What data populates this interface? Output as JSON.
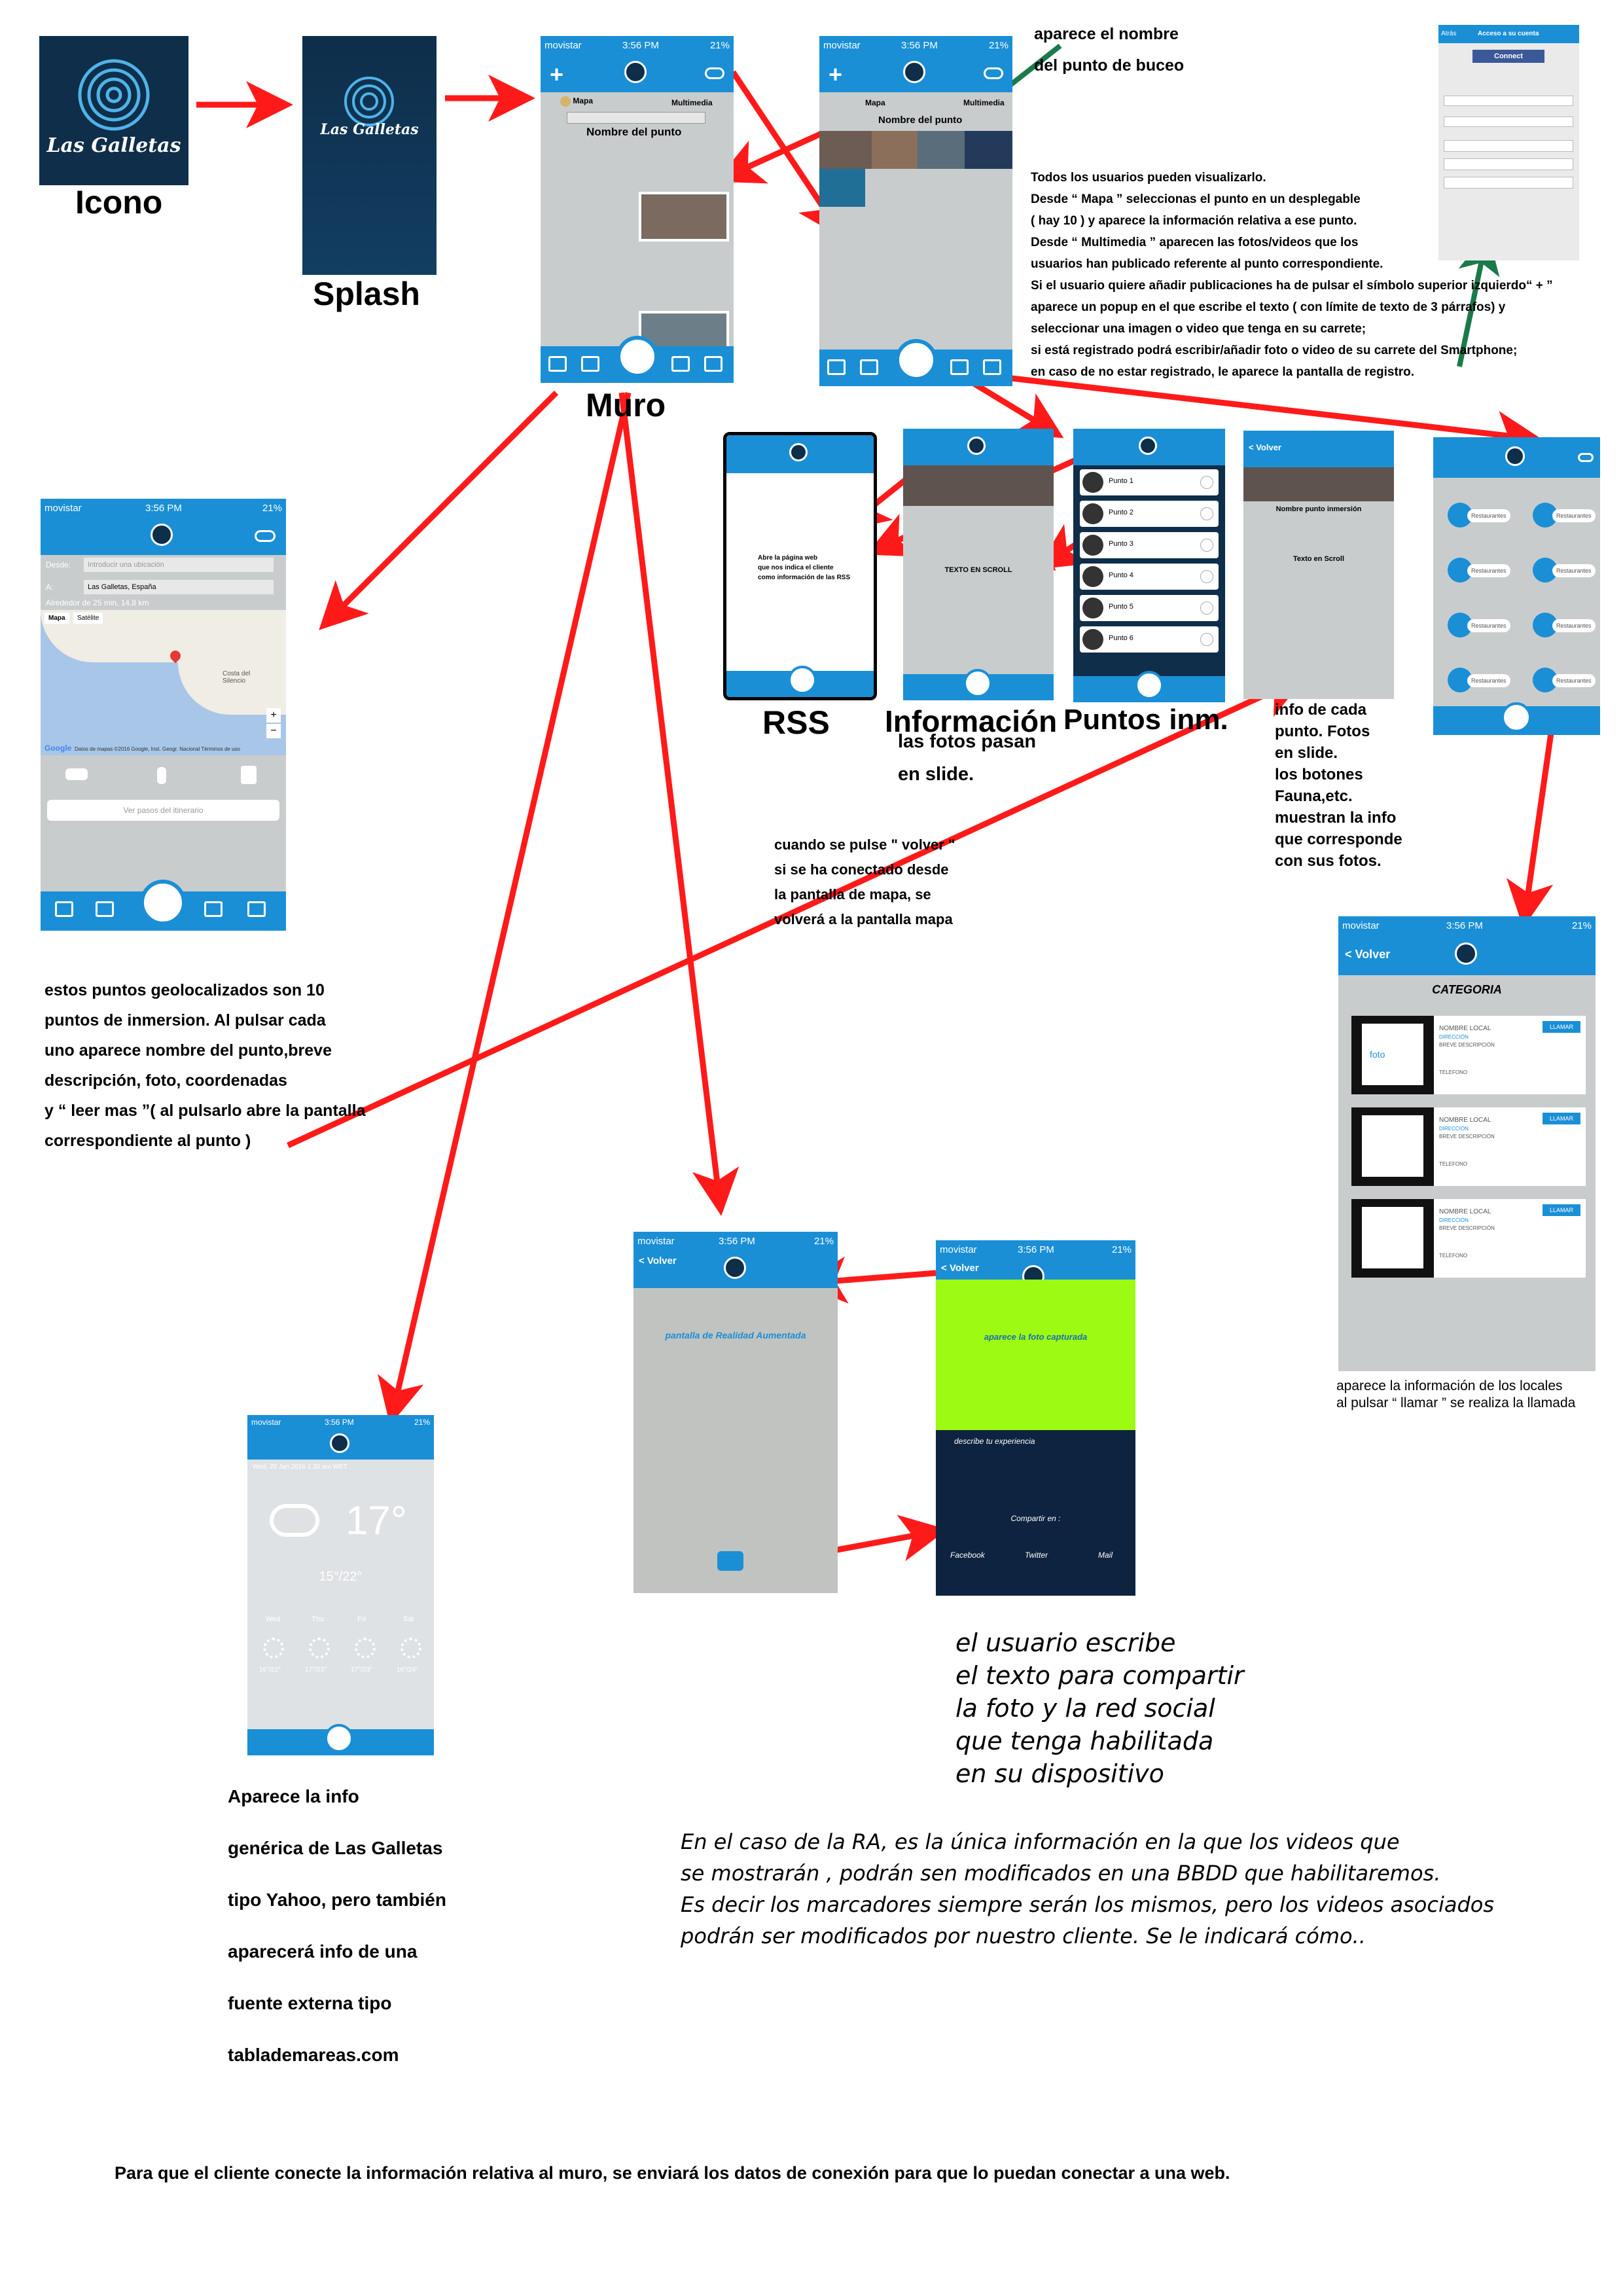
{
  "status": {
    "carrier": "movistar",
    "time": "3:56 PM",
    "battery": "21%"
  },
  "labels": {
    "icono": "Icono",
    "splash": "Splash",
    "muro": "Muro",
    "rss": "RSS",
    "informacion": "Información",
    "puntos": "Puntos inm."
  },
  "brand": {
    "logo_text": "Las Galletas",
    "primary_color": "#1a8fd6",
    "dark_color": "#0e2e4a"
  },
  "notes": {
    "buceo": [
      "aparece el nombre",
      "del punto de buceo"
    ],
    "todos": [
      "Todos los usuarios pueden visualizarlo.",
      "Desde “ Mapa ” seleccionas el punto en un desplegable",
      "( hay 10 ) y aparece la información relativa a ese punto.",
      "Desde “ Multimedia ” aparecen las fotos/videos que los",
      "usuarios han publicado referente al punto correspondiente.",
      "Si el usuario quiere añadir publicaciones ha de pulsar el símbolo superior izquierdo“ + ”",
      "aparece un popup en el que escribe el texto ( con límite de texto de 3 párrafos) y",
      "seleccionar una imagen o video que tenga en su carrete;",
      "si está registrado podrá escribir/añadir foto o video de su carrete del Smartphone;",
      "en caso de no estar registrado, le aparece la pantalla de registro."
    ],
    "fotos_slide": [
      "las fotos pasan",
      "en slide."
    ],
    "info_punto": [
      "info de cada",
      "punto. Fotos",
      "en slide.",
      "los botones",
      "Fauna,etc.",
      "muestran la info",
      "que corresponde",
      "con sus fotos."
    ],
    "volver": [
      "cuando se pulse \" volver \"",
      "si se ha conectado desde",
      "la pantalla de mapa, se",
      "volverá a la pantalla mapa"
    ],
    "geoloc": [
      "estos puntos geolocalizados son 10",
      "puntos de inmersion. Al pulsar cada",
      "uno aparece nombre del punto,breve",
      "descripción, foto, coordenadas",
      "y “ leer mas ”( al pulsarlo abre la pantalla",
      "correspondiente al punto )"
    ],
    "locales": [
      "aparece la información de los locales",
      "al pulsar “ llamar ” se realiza la llamada"
    ],
    "usuario": [
      "el usuario escribe",
      "el texto para compartir",
      "la foto y la red social",
      "que tenga habilitada",
      "en su dispositivo"
    ],
    "yahoo": [
      "Aparece la info",
      "genérica de Las Galletas",
      "tipo Yahoo, pero también",
      "aparecerá info de una",
      "fuente externa tipo",
      "tablademareas.com"
    ],
    "ra": [
      "En el caso de la RA, es la única información en la que los videos que",
      "se mostrarán , podrán sen modificados en una BBDD que habilitaremos.",
      "Es decir los marcadores siempre serán los mismos, pero los videos asociados",
      "podrán ser modificados por nuestro cliente. Se le indicará cómo.."
    ],
    "footer": "Para que el cliente conecte la información relativa al muro, se enviará los datos de conexión para que lo puedan conectar a una web."
  },
  "screens": {
    "muro": {
      "tab_map": "Mapa",
      "tab_multi": "Multimedia",
      "title": "Nombre del punto"
    },
    "multimedia": {
      "tab_map": "Mapa",
      "tab_multi": "Multimedia",
      "title": "Nombre del punto"
    },
    "login": {
      "title": "Acceso a su cuenta",
      "back": "Atrás",
      "connect": "Connect"
    },
    "rss": {
      "text": [
        "Abre la página web",
        "que nos indica el cliente",
        "como información de las RSS"
      ]
    },
    "info": {
      "text": "TEXTO EN SCROLL"
    },
    "puntos": {
      "items": [
        "Punto 1",
        "Punto 2",
        "Punto 3",
        "Punto 4",
        "Punto 5",
        "Punto 6"
      ]
    },
    "punto_detalle": {
      "back": "< Volver",
      "title": "Nombre punto inmersión",
      "text": "Texto en Scroll"
    },
    "social": {
      "item": "Restaurantes"
    },
    "mapa": {
      "desde_label": "Desde:",
      "desde_placeholder": "Introducir una ubicación",
      "a_label": "A:",
      "a_value": "Las Galletas, España",
      "distance": "Alrededor de 25 min, 14,8 km",
      "map_tab": "Mapa",
      "sat_tab": "Satélite",
      "google": "Google",
      "credits": "Datos de mapas ©2016 Google, Inst. Geogr. Nacional   Términos de uso",
      "steps": "Ver pasos del itinerario",
      "place": "Costa del Silencio"
    },
    "categoria": {
      "back": "< Volver",
      "title": "CATEGORIA",
      "foto": "foto",
      "name": "NOMBRE LOCAL",
      "address": "DIRECCIÓN",
      "desc": "BREVE DESCRIPCIÓN",
      "phone": "TELEFONO",
      "call": "LLAMAR"
    },
    "ra": {
      "back": "< Volver",
      "text": "pantalla de Realidad Aumentada"
    },
    "share": {
      "back": "< Volver",
      "photo": "aparece la foto capturada",
      "describe": "describe tu experiencia",
      "compartir": "Compartir en :",
      "facebook": "Facebook",
      "twitter": "Twitter",
      "mail": "Mail"
    },
    "tiempo": {
      "date": "Wed, 20 Jan 2016 1:30 am WET",
      "temp": "17°",
      "range": "15°/22°",
      "days": [
        "Wed",
        "Thu",
        "Fri",
        "Sat"
      ],
      "ranges": [
        "16°/22°",
        "17°/23°",
        "17°/23°",
        "16°/24°"
      ]
    }
  }
}
